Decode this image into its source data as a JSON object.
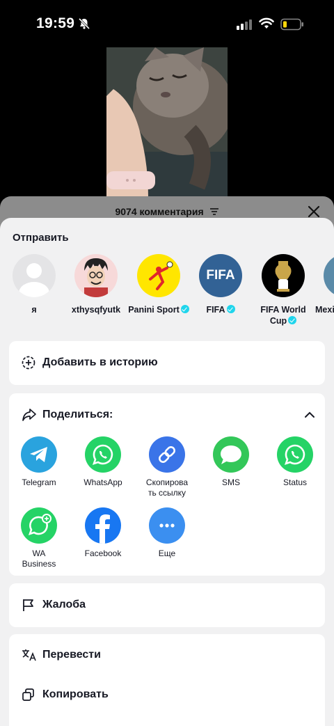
{
  "status_bar": {
    "time": "19:59"
  },
  "comments": {
    "title": "9074 комментария"
  },
  "share": {
    "send_label": "Отправить",
    "contacts": [
      {
        "name": "я",
        "verified": false
      },
      {
        "name": "xthysqfyutk",
        "verified": false
      },
      {
        "name": "Panini Sport",
        "verified": true
      },
      {
        "name": "FIFA",
        "verified": true,
        "avatar_text": "FIFA"
      },
      {
        "name_line1": "FIFA World",
        "name_line2": "Cup",
        "verified": true
      },
      {
        "name": "Mexi",
        "verified": false
      }
    ],
    "add_story": "Добавить в историю",
    "share_to": "Поделиться:",
    "apps": [
      {
        "label": "Telegram",
        "color": "#2aa3de"
      },
      {
        "label": "WhatsApp",
        "color": "#25d366"
      },
      {
        "label_line1": "Скопирова",
        "label_line2": "ть ссылку",
        "color": "#3a74e8"
      },
      {
        "label": "SMS",
        "color": "#33c759"
      },
      {
        "label": "Status",
        "color": "#25d366"
      },
      {
        "label_line1": "WA",
        "label_line2": "Business",
        "color": "#25d366"
      },
      {
        "label": "Facebook",
        "color": "#1877f2"
      },
      {
        "label": "Еще",
        "color": "#3b8ff0"
      }
    ],
    "report": "Жалоба",
    "translate": "Перевести",
    "copy": "Копировать"
  }
}
